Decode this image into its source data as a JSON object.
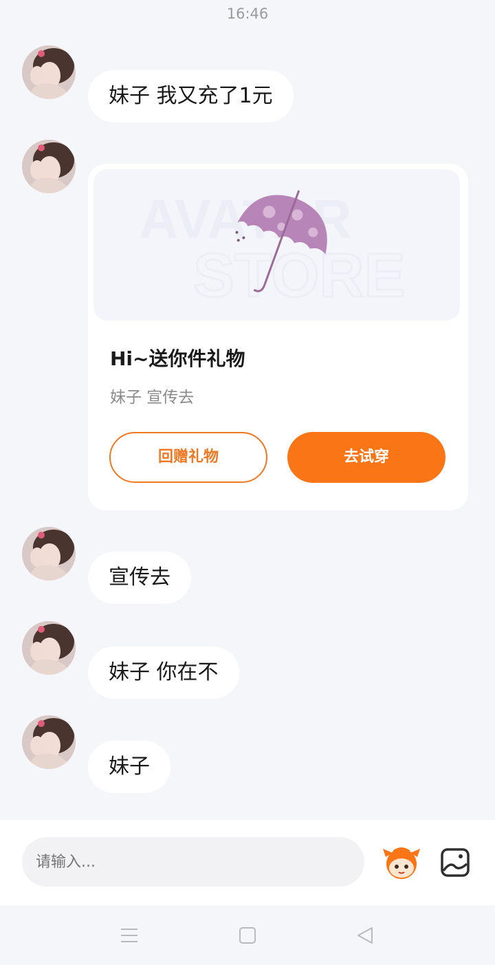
{
  "status_bar": {
    "time": "16:46"
  },
  "messages": [
    {
      "type": "text",
      "text": "妹子 我又充了1元"
    },
    {
      "type": "gift_card",
      "title": "Hi~送你件礼物",
      "subtitle": "妹子 宣传去",
      "return_gift_label": "回赠礼物",
      "try_on_label": "去试穿",
      "watermark": [
        "AVATAR",
        "STORE"
      ]
    },
    {
      "type": "text",
      "text": "宣传去"
    },
    {
      "type": "text",
      "text": "妹子 你在不"
    },
    {
      "type": "text",
      "text": "妹子"
    }
  ],
  "composer": {
    "placeholder": "请输入..."
  },
  "icons": {
    "emoji": "mascot-emoji-icon",
    "image": "image-picker-icon",
    "nav": [
      "menu-icon",
      "home-square-icon",
      "back-triangle-icon"
    ]
  },
  "colors": {
    "accent": "#f97516",
    "background": "#f5f6fa",
    "bubble": "#ffffff"
  }
}
